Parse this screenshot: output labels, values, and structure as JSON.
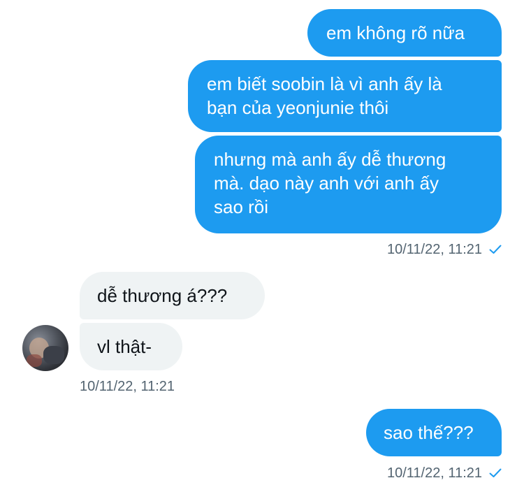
{
  "conversation": {
    "sent_group_1": {
      "messages": [
        {
          "lines": [
            "em không rõ nữa"
          ]
        },
        {
          "lines": [
            "em biết soobin là vì anh ấy là",
            "bạn của yeonjunie thôi"
          ]
        },
        {
          "lines": [
            "nhưng mà anh ấy dễ thương",
            "mà. dạo này anh với anh ấy",
            "sao rồi"
          ]
        }
      ],
      "timestamp": "10/11/22, 11:21",
      "status_icon": "check-icon"
    },
    "received_group": {
      "messages": [
        {
          "lines": [
            "dễ thương á???"
          ]
        },
        {
          "lines": [
            "vl thật-"
          ]
        }
      ],
      "timestamp": "10/11/22, 11:21",
      "avatar_icon": "user-avatar"
    },
    "sent_group_2": {
      "messages": [
        {
          "lines": [
            "sao thế???"
          ]
        }
      ],
      "timestamp": "10/11/22, 11:21",
      "status_icon": "check-icon"
    }
  },
  "colors": {
    "sent_bubble": "#1d9bf0",
    "received_bubble": "#eff3f4",
    "meta_text": "#536471",
    "check": "#1d9bf0"
  }
}
